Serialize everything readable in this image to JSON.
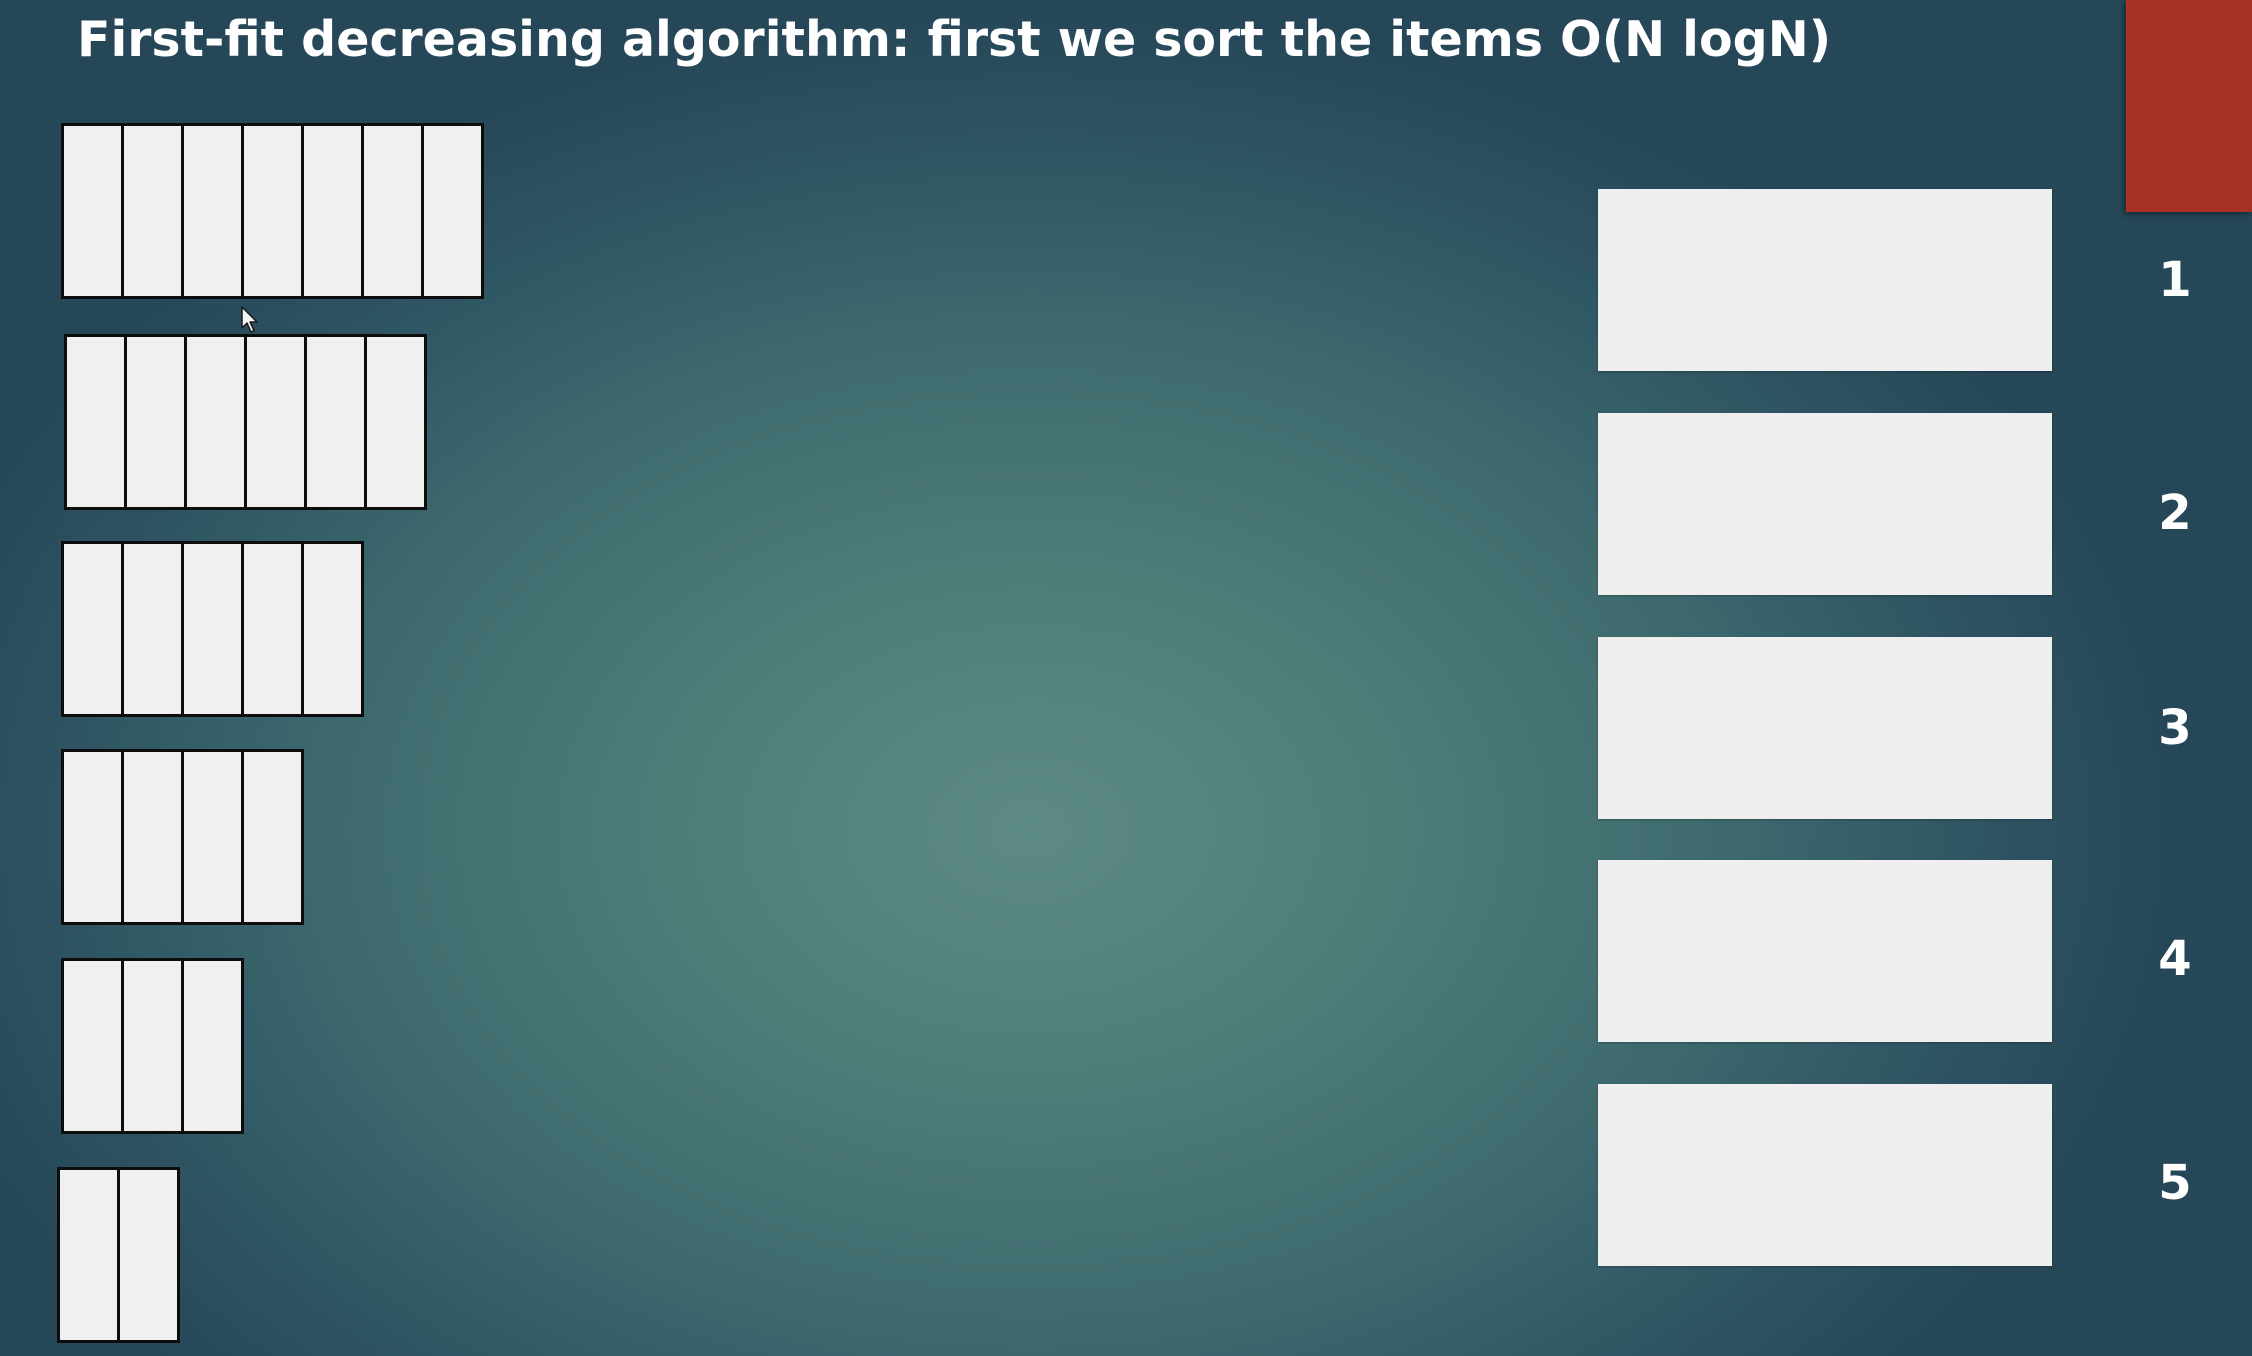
{
  "title": "First-fit decreasing algorithm: first we sort the items O(N logN)",
  "colors": {
    "background_center": "#5d8a84",
    "background_edge": "#264758",
    "accent": "#a83325",
    "item_fill": "#f0f0f0",
    "item_border": "#0d0d0d",
    "bin_fill": "#efefef",
    "text": "#ffffff"
  },
  "items": [
    {
      "units": 7
    },
    {
      "units": 6
    },
    {
      "units": 5
    },
    {
      "units": 4
    },
    {
      "units": 3
    },
    {
      "units": 2
    }
  ],
  "bins": [
    {
      "label": "1"
    },
    {
      "label": "2"
    },
    {
      "label": "3"
    },
    {
      "label": "4"
    },
    {
      "label": "5"
    }
  ],
  "icons": {
    "cursor": "mouse-pointer-icon"
  }
}
